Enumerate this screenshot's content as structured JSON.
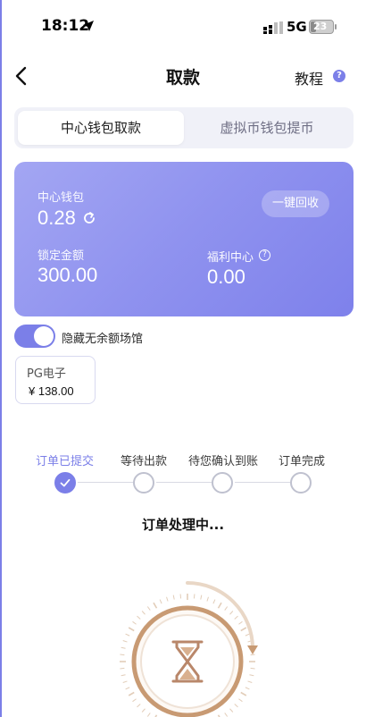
{
  "status_bar": {
    "time": "18:12",
    "network": "5G",
    "battery": "23"
  },
  "header": {
    "title": "取款",
    "tutorial": "教程",
    "help": "?"
  },
  "tabs": [
    {
      "label": "中心钱包取款",
      "active": true
    },
    {
      "label": "虚拟币钱包提币",
      "active": false
    }
  ],
  "wallet": {
    "center_label": "中心钱包",
    "center_value": "0.28",
    "one_key_label": "一键回收",
    "locked_label": "锁定金额",
    "locked_value": "300.00",
    "welfare_label": "福利中心",
    "welfare_value": "0.00"
  },
  "hide_toggle": {
    "label": "隐藏无余额场馆",
    "on": true
  },
  "venue": {
    "name": "PG电子",
    "amount": "¥ 138.00"
  },
  "steps": [
    {
      "label": "订单已提交",
      "done": true
    },
    {
      "label": "等待出款",
      "done": false
    },
    {
      "label": "待您确认到账",
      "done": false
    },
    {
      "label": "订单完成",
      "done": false
    }
  ],
  "processing_text": "订单处理中...",
  "colors": {
    "accent": "#7b7fe8",
    "card_start": "#a3a6f3",
    "card_end": "#7e81eb",
    "dial": "#c89a73"
  }
}
